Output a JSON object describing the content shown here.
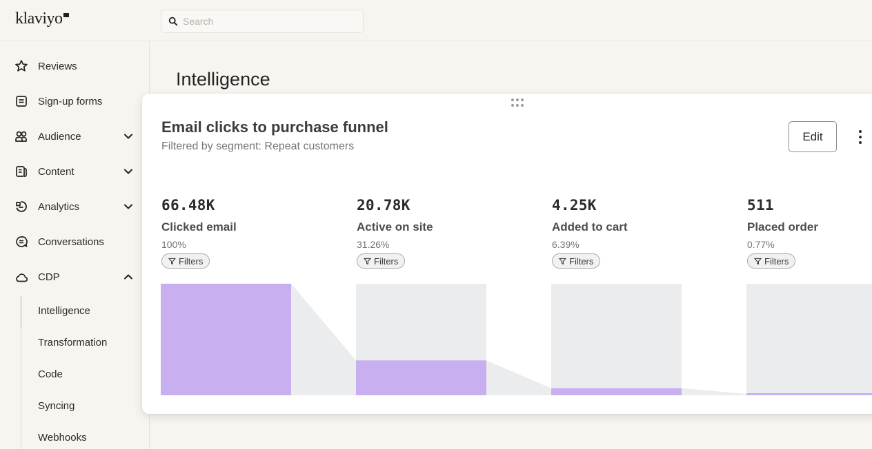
{
  "app": {
    "logo_text": "klaviyo",
    "search_placeholder": "Search"
  },
  "sidebar": {
    "items": [
      {
        "label": "Reviews",
        "icon": "star-icon",
        "chevron": null
      },
      {
        "label": "Sign-up forms",
        "icon": "form-icon",
        "chevron": null
      },
      {
        "label": "Audience",
        "icon": "people-icon",
        "chevron": "down"
      },
      {
        "label": "Content",
        "icon": "content-icon",
        "chevron": "down"
      },
      {
        "label": "Analytics",
        "icon": "analytics-icon",
        "chevron": "down"
      },
      {
        "label": "Conversations",
        "icon": "chat-icon",
        "chevron": null
      },
      {
        "label": "CDP",
        "icon": "cloud-icon",
        "chevron": "up"
      }
    ],
    "cdp_subitems": [
      {
        "label": "Intelligence",
        "active": true
      },
      {
        "label": "Transformation",
        "active": false
      },
      {
        "label": "Code",
        "active": false
      },
      {
        "label": "Syncing",
        "active": false
      },
      {
        "label": "Webhooks",
        "active": false
      }
    ]
  },
  "page": {
    "title": "Intelligence"
  },
  "card": {
    "title": "Email clicks to purchase funnel",
    "subtitle": "Filtered by segment: Repeat customers",
    "edit_label": "Edit",
    "filter_label": "Filters"
  },
  "colors": {
    "accent_bar": "#c8aff0",
    "track": "#ebecee",
    "background": "#f8f5f1"
  },
  "chart_data": {
    "type": "bar",
    "title": "Email clicks to purchase funnel",
    "subtitle": "Filtered by segment: Repeat customers",
    "categories": [
      "Clicked email",
      "Active on site",
      "Added to cart",
      "Placed order"
    ],
    "display_values": [
      "66.48K",
      "20.78K",
      "4.25K",
      "511"
    ],
    "values": [
      66480,
      20780,
      4250,
      511
    ],
    "percentages": [
      "100%",
      "31.26%",
      "6.39%",
      "0.77%"
    ],
    "percent_values": [
      100,
      31.26,
      6.39,
      0.77
    ],
    "ylim": [
      0,
      100
    ],
    "xlabel": "",
    "ylabel": "",
    "grid": false,
    "legend": "none"
  }
}
